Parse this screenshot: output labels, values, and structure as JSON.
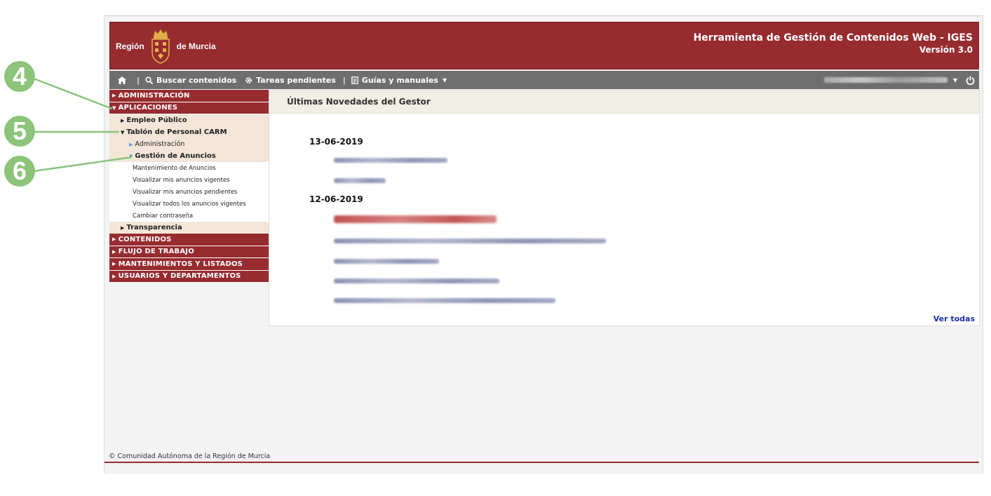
{
  "header": {
    "logo_left": "Región",
    "logo_right": "de Murcia",
    "title": "Herramienta de Gestión de Contenidos Web - IGES",
    "version": "Versión 3.0"
  },
  "navbar": {
    "items": [
      {
        "label": "Buscar contenidos",
        "icon": "search-icon"
      },
      {
        "label": "Tareas pendientes",
        "icon": "gear-icon"
      },
      {
        "label": "Guías y manuales",
        "icon": "document-icon"
      }
    ],
    "separator": "|"
  },
  "sidebar": {
    "sections": {
      "administracion": "ADMINISTRACIÓN",
      "aplicaciones": "APLICACIONES",
      "contenidos": "CONTENIDOS",
      "flujo": "FLUJO DE TRABAJO",
      "mantenimientos": "MANTENIMIENTOS Y LISTADOS",
      "usuarios": "USUARIOS Y DEPARTAMENTOS"
    },
    "aplicaciones_children": {
      "empleo": "Empleo Público",
      "tablon": "Tablón de Personal CARM",
      "tablon_admin": "Administración",
      "gestion": "Gestión de Anuncios",
      "transparencia": "Transparencia"
    },
    "gestion_children": [
      "Mantenimiento de Anuncios",
      "Visualizar mis anuncios vigentes",
      "Visualizar mis anuncios pendientes",
      "Visualizar todos los anuncios vigentes",
      "Cambiar contraseña"
    ]
  },
  "main": {
    "header": "Últimas Novedades del Gestor",
    "dates": [
      "13-06-2019",
      "12-06-2019"
    ],
    "ver_todas": "Ver todas"
  },
  "footer": {
    "copyright": "© Comunidad Autónoma de la Región de Murcia"
  },
  "callouts": [
    "4",
    "5",
    "6"
  ],
  "colors": {
    "brand_red": "#962b30",
    "navbar_gray": "#6e6e6e",
    "submenu_beige": "#f3e6d8",
    "callout_green": "#8cc47a",
    "link_blue": "#1a2fb0"
  }
}
